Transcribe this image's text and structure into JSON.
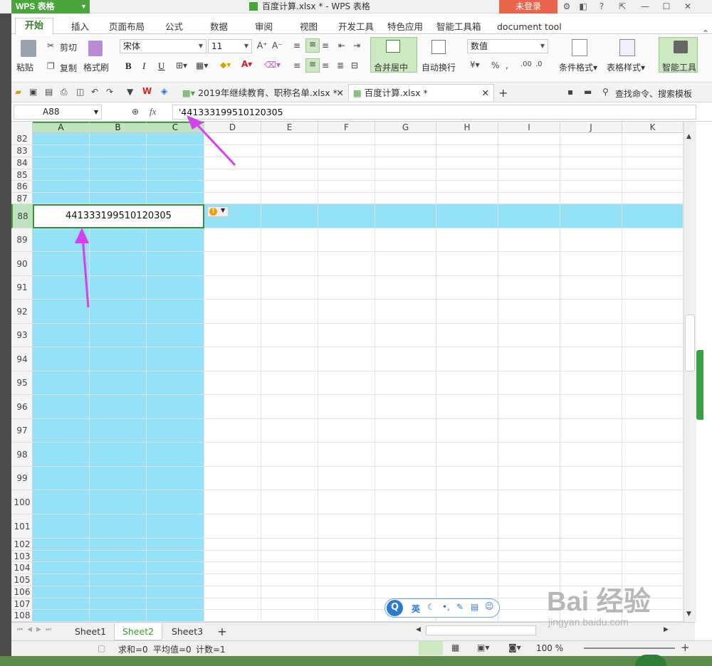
{
  "app": {
    "logo": "WPS 表格",
    "window_title": "百度计算.xlsx * - WPS 表格",
    "login": "未登录"
  },
  "menu_tabs": [
    "开始",
    "插入",
    "页面布局",
    "公式",
    "数据",
    "审阅",
    "视图",
    "开发工具",
    "特色应用",
    "智能工具箱",
    "document tool"
  ],
  "ribbon": {
    "paste": "粘贴",
    "cut": "剪切",
    "copy": "复制",
    "format_painter": "格式刷",
    "font_name": "宋体",
    "font_size": "11",
    "bold": "B",
    "italic": "I",
    "underline": "U",
    "merge_center": "合并居中",
    "wrap_text": "自动换行",
    "number_format": "数值",
    "percent": "%",
    "conditional_format": "条件格式",
    "table_style": "表格样式",
    "smart_tools": "智能工具"
  },
  "doc_tabs": [
    {
      "label": "2019年继续教育、职称名单.xlsx *"
    },
    {
      "label": "百度计算.xlsx *"
    }
  ],
  "search_command": "查找命令、搜索模板",
  "formula_bar": {
    "name_box": "A88",
    "fx": "fx",
    "formula": "'441333199510120305"
  },
  "columns": [
    "A",
    "B",
    "C",
    "D",
    "E",
    "F",
    "G",
    "H",
    "I",
    "J",
    "K"
  ],
  "rows": [
    "82",
    "83",
    "84",
    "85",
    "86",
    "87",
    "88",
    "89",
    "90",
    "91",
    "92",
    "93",
    "94",
    "95",
    "96",
    "97",
    "98",
    "99",
    "100",
    "101",
    "102",
    "103",
    "104",
    "105",
    "106",
    "107",
    "108"
  ],
  "active_cell_value": "441333199510120305",
  "sheets": [
    "Sheet1",
    "Sheet2",
    "Sheet3"
  ],
  "active_sheet": "Sheet2",
  "status": {
    "sum": "求和=0",
    "avg": "平均值=0",
    "count": "计数=1",
    "zoom": "100 %"
  },
  "ime": {
    "label": "英"
  },
  "watermark": {
    "text": "Bai 经验",
    "url": "jingyan.baidu.com"
  },
  "colors": {
    "accent": "#4aa43c",
    "selection": "#93e2f7",
    "arrow": "#d63ff0",
    "login": "#e8644a"
  }
}
